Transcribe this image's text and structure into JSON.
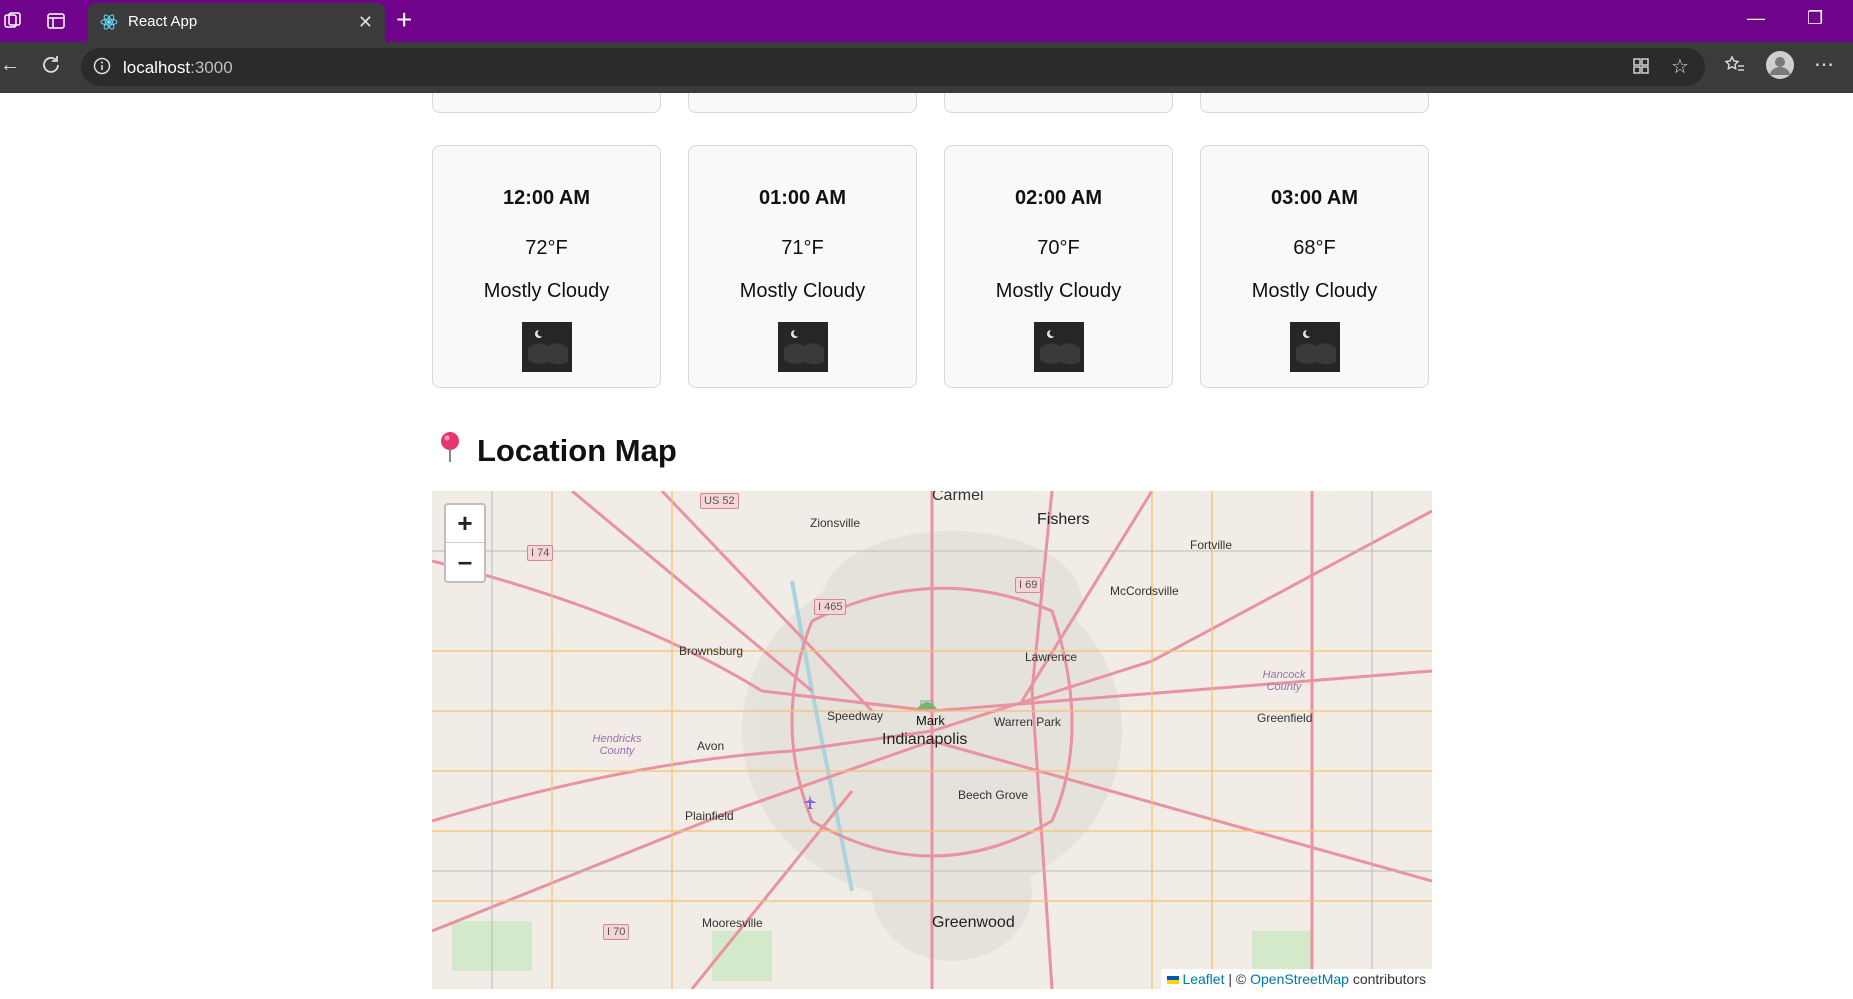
{
  "browser": {
    "tab_title": "React App",
    "url_host": "localhost",
    "url_port": ":3000",
    "accent_color": "#6f0389"
  },
  "hourly": {
    "previous_row_count": 4,
    "cards": [
      {
        "time": "12:00 AM",
        "temp": "72°F",
        "condition": "Mostly Cloudy",
        "icon": "night-cloudy-icon"
      },
      {
        "time": "01:00 AM",
        "temp": "71°F",
        "condition": "Mostly Cloudy",
        "icon": "night-cloudy-icon"
      },
      {
        "time": "02:00 AM",
        "temp": "70°F",
        "condition": "Mostly Cloudy",
        "icon": "night-cloudy-icon"
      },
      {
        "time": "03:00 AM",
        "temp": "68°F",
        "condition": "Mostly Cloudy",
        "icon": "night-cloudy-icon"
      }
    ]
  },
  "map_section": {
    "title": "Location Map",
    "icon": "pin-icon",
    "zoom_in": "+",
    "zoom_out": "–",
    "marker_label": "Mark",
    "attribution": {
      "leaflet": "Leaflet",
      "sep": " | © ",
      "osm": "OpenStreetMap",
      "tail": " contributors"
    },
    "places": {
      "indianapolis": "Indianapolis",
      "carmel": "Carmel",
      "fishers": "Fishers",
      "zionsville": "Zionsville",
      "fortville": "Fortville",
      "mccordsville": "McCordsville",
      "brownsburg": "Brownsburg",
      "lawrence": "Lawrence",
      "speedway": "Speedway",
      "warren_park": "Warren Park",
      "greenfield": "Greenfield",
      "avon": "Avon",
      "beech_grove": "Beech Grove",
      "plainfield": "Plainfield",
      "mooresville": "Mooresville",
      "greenwood": "Greenwood",
      "hendricks": "Hendricks County",
      "hancock": "Hancock County"
    },
    "shields": {
      "us52": "US 52",
      "i74": "I 74",
      "i465": "I 465",
      "i69": "I 69",
      "i70": "I 70"
    }
  }
}
